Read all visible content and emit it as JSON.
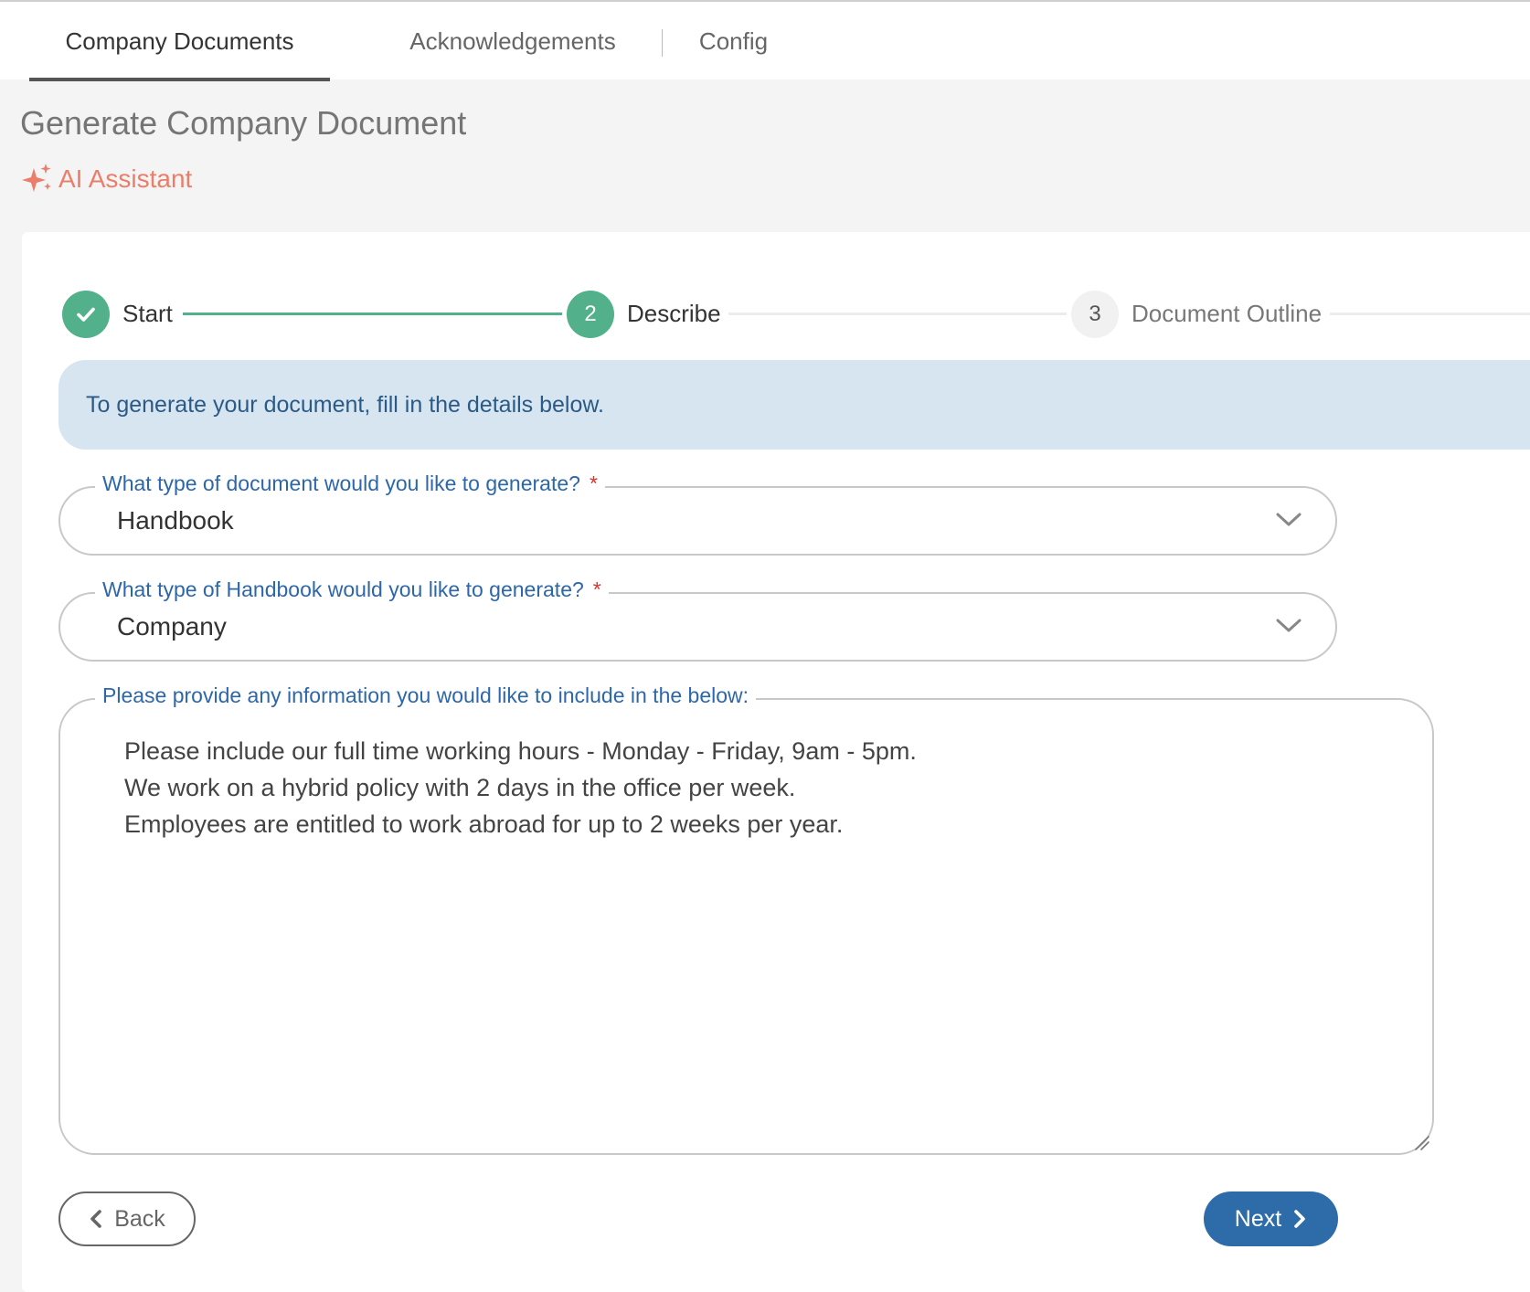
{
  "tabs": [
    {
      "label": "Company Documents",
      "active": true
    },
    {
      "label": "Acknowledgements",
      "active": false
    },
    {
      "label": "Config",
      "active": false
    }
  ],
  "page": {
    "title": "Generate Company Document",
    "ai_assistant_label": "AI Assistant"
  },
  "stepper": {
    "steps": [
      {
        "number": "",
        "label": "Start",
        "state": "completed"
      },
      {
        "number": "2",
        "label": "Describe",
        "state": "active"
      },
      {
        "number": "3",
        "label": "Document Outline",
        "state": "upcoming"
      }
    ]
  },
  "info_message": "To generate your document, fill in the details below.",
  "form": {
    "document_type": {
      "label": "What type of document would you like to generate?",
      "required_mark": "*",
      "value": "Handbook"
    },
    "handbook_type": {
      "label": "What type of Handbook would you like to generate?",
      "required_mark": "*",
      "value": "Company"
    },
    "details": {
      "label": "Please provide any information you would like to include in the below:",
      "lines": [
        "Please include our full time working hours - Monday - Friday, 9am - 5pm.",
        "We work on a hybrid policy with 2 days in the office per week.",
        "Employees are entitled to work abroad for up to 2 weeks per year."
      ]
    }
  },
  "buttons": {
    "back_label": "Back",
    "next_label": "Next"
  },
  "colors": {
    "accent_green": "#52b18a",
    "primary_blue": "#2e6ca9",
    "ai_coral": "#ea7e6a",
    "info_bg": "#d6e5f0",
    "label_blue": "#2d67a9",
    "required_red": "#d8352d"
  }
}
